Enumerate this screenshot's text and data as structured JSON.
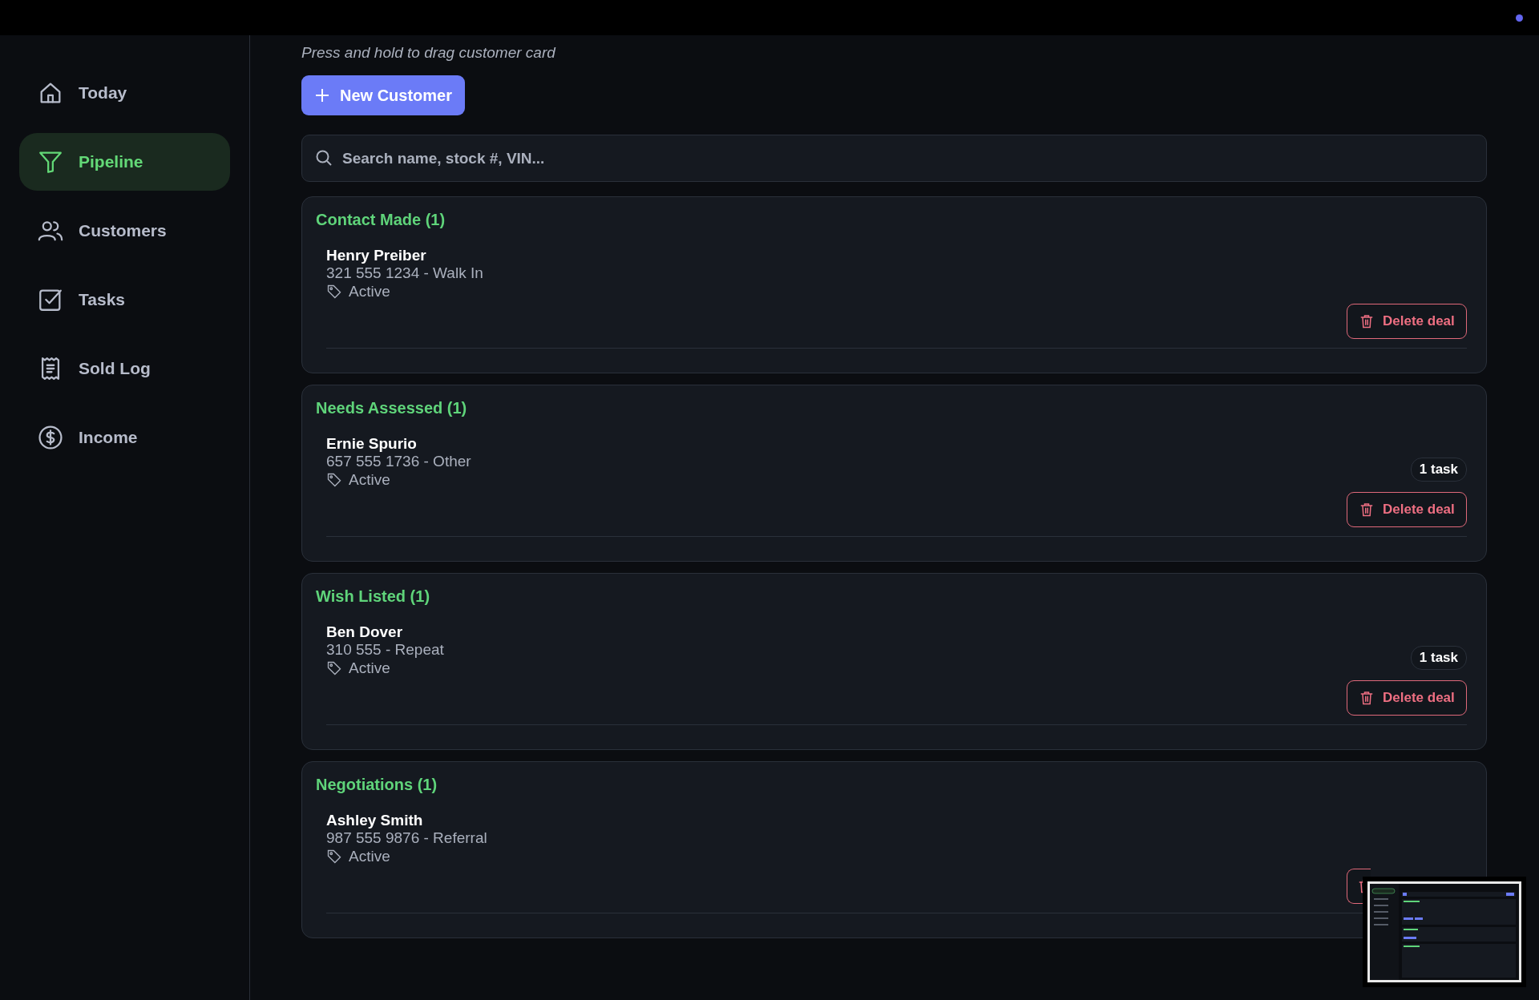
{
  "sidebar": {
    "items": [
      {
        "label": "Today",
        "selected": false
      },
      {
        "label": "Pipeline",
        "selected": true
      },
      {
        "label": "Customers",
        "selected": false
      },
      {
        "label": "Tasks",
        "selected": false
      },
      {
        "label": "Sold Log",
        "selected": false
      },
      {
        "label": "Income",
        "selected": false
      }
    ]
  },
  "hint": "Press and hold to drag customer card",
  "new_customer_button": {
    "label": "New Customer"
  },
  "search": {
    "placeholder": "Search name, stock #, VIN..."
  },
  "stages": [
    {
      "title": "Contact Made (1)",
      "deals": [
        {
          "name": "Henry Preiber",
          "details": "321 555 1234 - Walk In",
          "status": "Active",
          "delete_label": "Delete deal"
        }
      ]
    },
    {
      "title": "Needs Assessed (1)",
      "deals": [
        {
          "name": "Ernie Spurio",
          "details": "657 555 1736 - Other",
          "status": "Active",
          "tasks_badge": "1 task",
          "delete_label": "Delete deal"
        }
      ]
    },
    {
      "title": "Wish Listed (1)",
      "deals": [
        {
          "name": "Ben Dover",
          "details": "310 555 - Repeat",
          "status": "Active",
          "tasks_badge": "1 task",
          "delete_label": "Delete deal"
        }
      ]
    },
    {
      "title": "Negotiations (1)",
      "deals": [
        {
          "name": "Ashley Smith",
          "details": "987 555 9876 - Referral",
          "status": "Active"
        }
      ]
    }
  ]
}
